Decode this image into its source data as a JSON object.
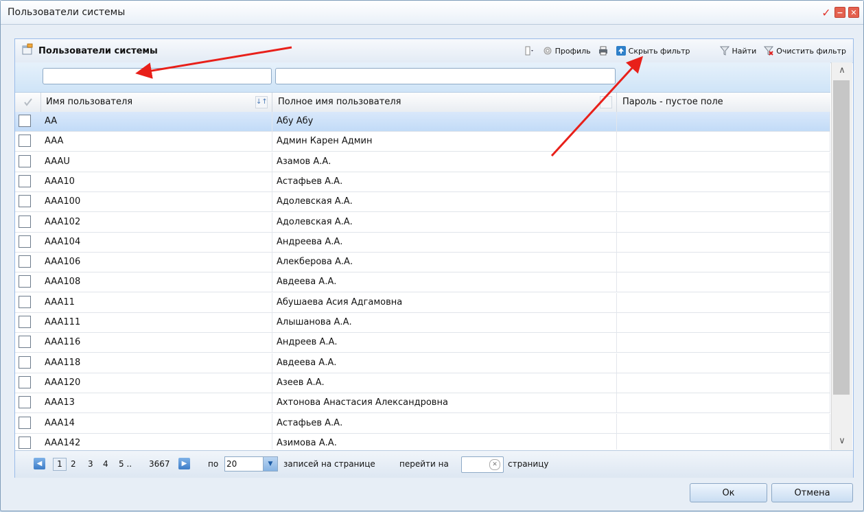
{
  "window": {
    "title": "Пользователи системы"
  },
  "panel": {
    "title": "Пользователи системы",
    "toolbar": {
      "profile": "Профиль",
      "hide_filter": "Скрыть фильтр",
      "find": "Найти",
      "clear_filter": "Очистить фильтр"
    }
  },
  "filter": {
    "username_value": "",
    "fullname_value": ""
  },
  "columns": [
    "Имя пользователя",
    "Полное имя пользователя",
    "Пароль - пустое поле"
  ],
  "rows": [
    {
      "login": "AA",
      "name": "Абу Абу",
      "pwd": ""
    },
    {
      "login": "AAA",
      "name": "Админ Карен Админ",
      "pwd": ""
    },
    {
      "login": "AAAU",
      "name": "Азамов А.А.",
      "pwd": ""
    },
    {
      "login": "AAA10",
      "name": "Астафьев А.А.",
      "pwd": ""
    },
    {
      "login": "AAA100",
      "name": "Адолевская А.А.",
      "pwd": ""
    },
    {
      "login": "AAA102",
      "name": "Адолевская А.А.",
      "pwd": ""
    },
    {
      "login": "AAA104",
      "name": "Андреева А.А.",
      "pwd": ""
    },
    {
      "login": "AAA106",
      "name": "Алекберова А.А.",
      "pwd": ""
    },
    {
      "login": "AAA108",
      "name": "Авдеева А.А.",
      "pwd": ""
    },
    {
      "login": "AAA11",
      "name": "Абушаева Асия Адгамовна",
      "pwd": ""
    },
    {
      "login": "AAA111",
      "name": "Алышанова А.А.",
      "pwd": ""
    },
    {
      "login": "AAA116",
      "name": "Андреев А.А.",
      "pwd": ""
    },
    {
      "login": "AAA118",
      "name": "Авдеева А.А.",
      "pwd": ""
    },
    {
      "login": "AAA120",
      "name": "Азеев А.А.",
      "pwd": ""
    },
    {
      "login": "AAA13",
      "name": "Ахтонова Анастасия Александровна",
      "pwd": ""
    },
    {
      "login": "AAA14",
      "name": "Астафьев А.А.",
      "pwd": ""
    },
    {
      "login": "AAA142",
      "name": "Азимова А.А.",
      "pwd": ""
    }
  ],
  "pager": {
    "current": "1",
    "pages": [
      "2",
      "3",
      "4",
      "5 .."
    ],
    "last": "3667",
    "per_label": "по",
    "per_value": "20",
    "per_suffix": "записей на странице",
    "goto_label": "перейти на",
    "goto_suffix": "страницу"
  },
  "buttons": {
    "ok": "Ок",
    "cancel": "Отмена"
  },
  "colors": {
    "annotation_arrow": "#e8201a",
    "selected_row": "#c9dff8",
    "accent": "#3c7cc7"
  }
}
